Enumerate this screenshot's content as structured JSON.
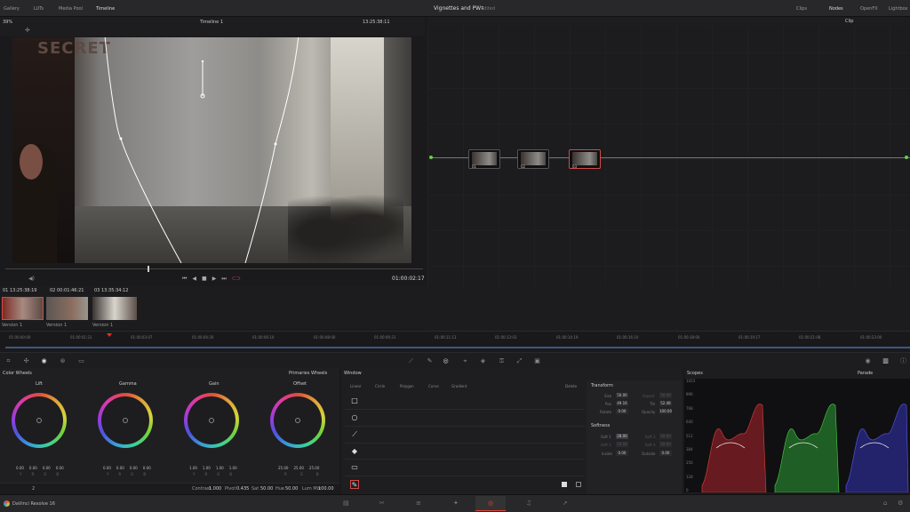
{
  "top_tabs": [
    "Gallery",
    "LUTs",
    "Media Pool",
    "Timeline"
  ],
  "project_title": "Vignettes and PWs",
  "project_status": "Edited",
  "top_right": [
    "Clips",
    "Nodes",
    "OpenFX",
    "Lightbox"
  ],
  "viewer": {
    "zoom": "39%",
    "timeline_name": "Timeline 1",
    "timecode_top": "13:25:38:11",
    "timecode": "01:00:02:17",
    "node_label": "Clip",
    "sign_text": "SECRET"
  },
  "clips": [
    {
      "num": "01",
      "tc": "13:25:38:19",
      "track": "V1",
      "version": "Version 1"
    },
    {
      "num": "02",
      "tc": "00:01:46:21",
      "track": "V1",
      "version": "Version 1"
    },
    {
      "num": "03",
      "tc": "13:35:34:12",
      "track": "V1",
      "version": "Version 1"
    }
  ],
  "timeline_ticks": [
    "01:00:00:00",
    "01:00:01:21",
    "01:00:03:07",
    "01:00:04:20",
    "01:00:06:10",
    "01:00:08:00",
    "01:00:09:21",
    "01:00:11:13",
    "01:00:13:03",
    "01:00:14:19",
    "01:00:16:10",
    "01:00:18:00",
    "01:00:19:17",
    "01:00:21:08",
    "01:00:23:00"
  ],
  "nodes": [
    {
      "label": "01"
    },
    {
      "label": "02"
    },
    {
      "label": "03"
    }
  ],
  "color_wheels": {
    "title": "Color Wheels",
    "mode": "Primaries Wheels",
    "wheels": [
      {
        "name": "Lift",
        "values": [
          "0.00",
          "0.00",
          "0.00",
          "0.00"
        ]
      },
      {
        "name": "Gamma",
        "values": [
          "0.00",
          "0.00",
          "0.00",
          "0.00"
        ]
      },
      {
        "name": "Gain",
        "values": [
          "1.00",
          "1.00",
          "1.00",
          "1.00"
        ]
      },
      {
        "name": "Offset",
        "values": [
          "25.00",
          "25.00",
          "25.00"
        ]
      }
    ],
    "channel_letters": [
      "Y",
      "R",
      "G",
      "B"
    ],
    "bottom": [
      {
        "label": "Contrast",
        "value": "1.000"
      },
      {
        "label": "Pivot",
        "value": "0.435"
      },
      {
        "label": "Sat",
        "value": "50.00"
      },
      {
        "label": "Hue",
        "value": "50.00"
      },
      {
        "label": "Lum Mix",
        "value": "100.00"
      }
    ],
    "page_num": "2"
  },
  "window_panel": {
    "title": "Window",
    "modes": [
      "Linear",
      "Circle",
      "Polygon",
      "Curve",
      "Gradient"
    ],
    "delete": "Delete",
    "transform": {
      "title": "Transform",
      "fields": [
        {
          "label": "Size",
          "value": "50.00"
        },
        {
          "label": "Aspect",
          "value": "50.00"
        },
        {
          "label": "Pan",
          "value": "49.16"
        },
        {
          "label": "Tilt",
          "value": "52.48"
        },
        {
          "label": "Rotate",
          "value": "0.00"
        },
        {
          "label": "Opacity",
          "value": "100.00"
        }
      ]
    },
    "softness": {
      "title": "Softness",
      "fields": [
        {
          "label": "Soft 1",
          "value": "28.00"
        },
        {
          "label": "Soft 2",
          "value": "50.00"
        },
        {
          "label": "Soft 3",
          "value": "50.00"
        },
        {
          "label": "Soft 4",
          "value": "50.00"
        },
        {
          "label": "Inside",
          "value": "0.00"
        },
        {
          "label": "Outside",
          "value": "0.00"
        }
      ]
    }
  },
  "scopes": {
    "title": "Scopes",
    "mode": "Parade",
    "scale": [
      "1023",
      "896",
      "768",
      "640",
      "512",
      "384",
      "256",
      "128",
      "0"
    ]
  },
  "footer": {
    "app_name": "DaVinci Resolve 16"
  },
  "colors": {
    "playhead": "#e0322a",
    "accent": "#e0443a",
    "node_line": "#6acb4a"
  }
}
